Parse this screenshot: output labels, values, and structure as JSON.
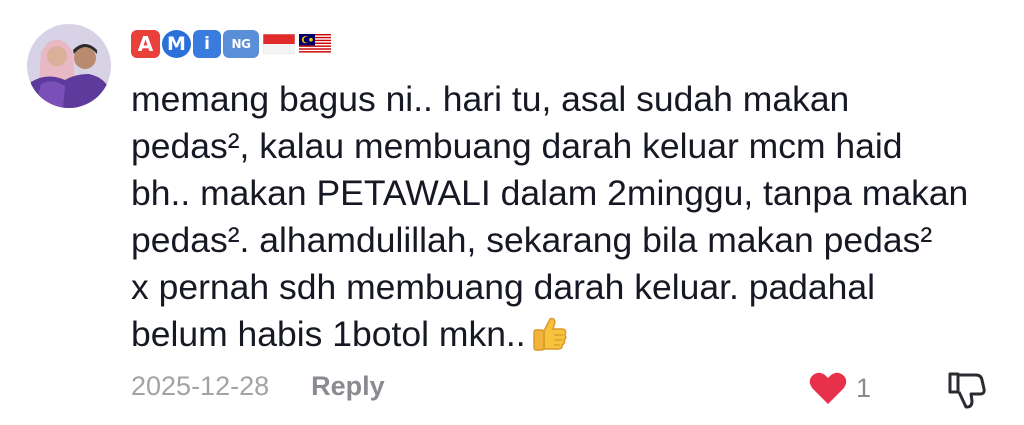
{
  "comment": {
    "avatar_icon": "profile-photo-couple",
    "username_badges": [
      "A",
      "M",
      "i",
      "NG"
    ],
    "flags": [
      "indonesia-flag-icon",
      "malaysia-flag-icon"
    ],
    "text_lines": [
      "memang bagus ni.. hari tu, asal sudah makan",
      "pedas², kalau membuang darah keluar mcm haid",
      "bh.. makan PETAWALI dalam 2minggu, tanpa makan",
      "pedas². alhamdulillah, sekarang bila makan pedas²",
      "x pernah sdh membuang darah keluar. padahal",
      "belum habis 1botol mkn.."
    ],
    "text_emoji": "thumbs-up-icon",
    "date": "2025-12-28",
    "reply_label": "Reply",
    "like_count": "1",
    "liked": true,
    "colors": {
      "text": "#161823",
      "muted": "#a2a3a7",
      "like": "#e8304a"
    }
  }
}
